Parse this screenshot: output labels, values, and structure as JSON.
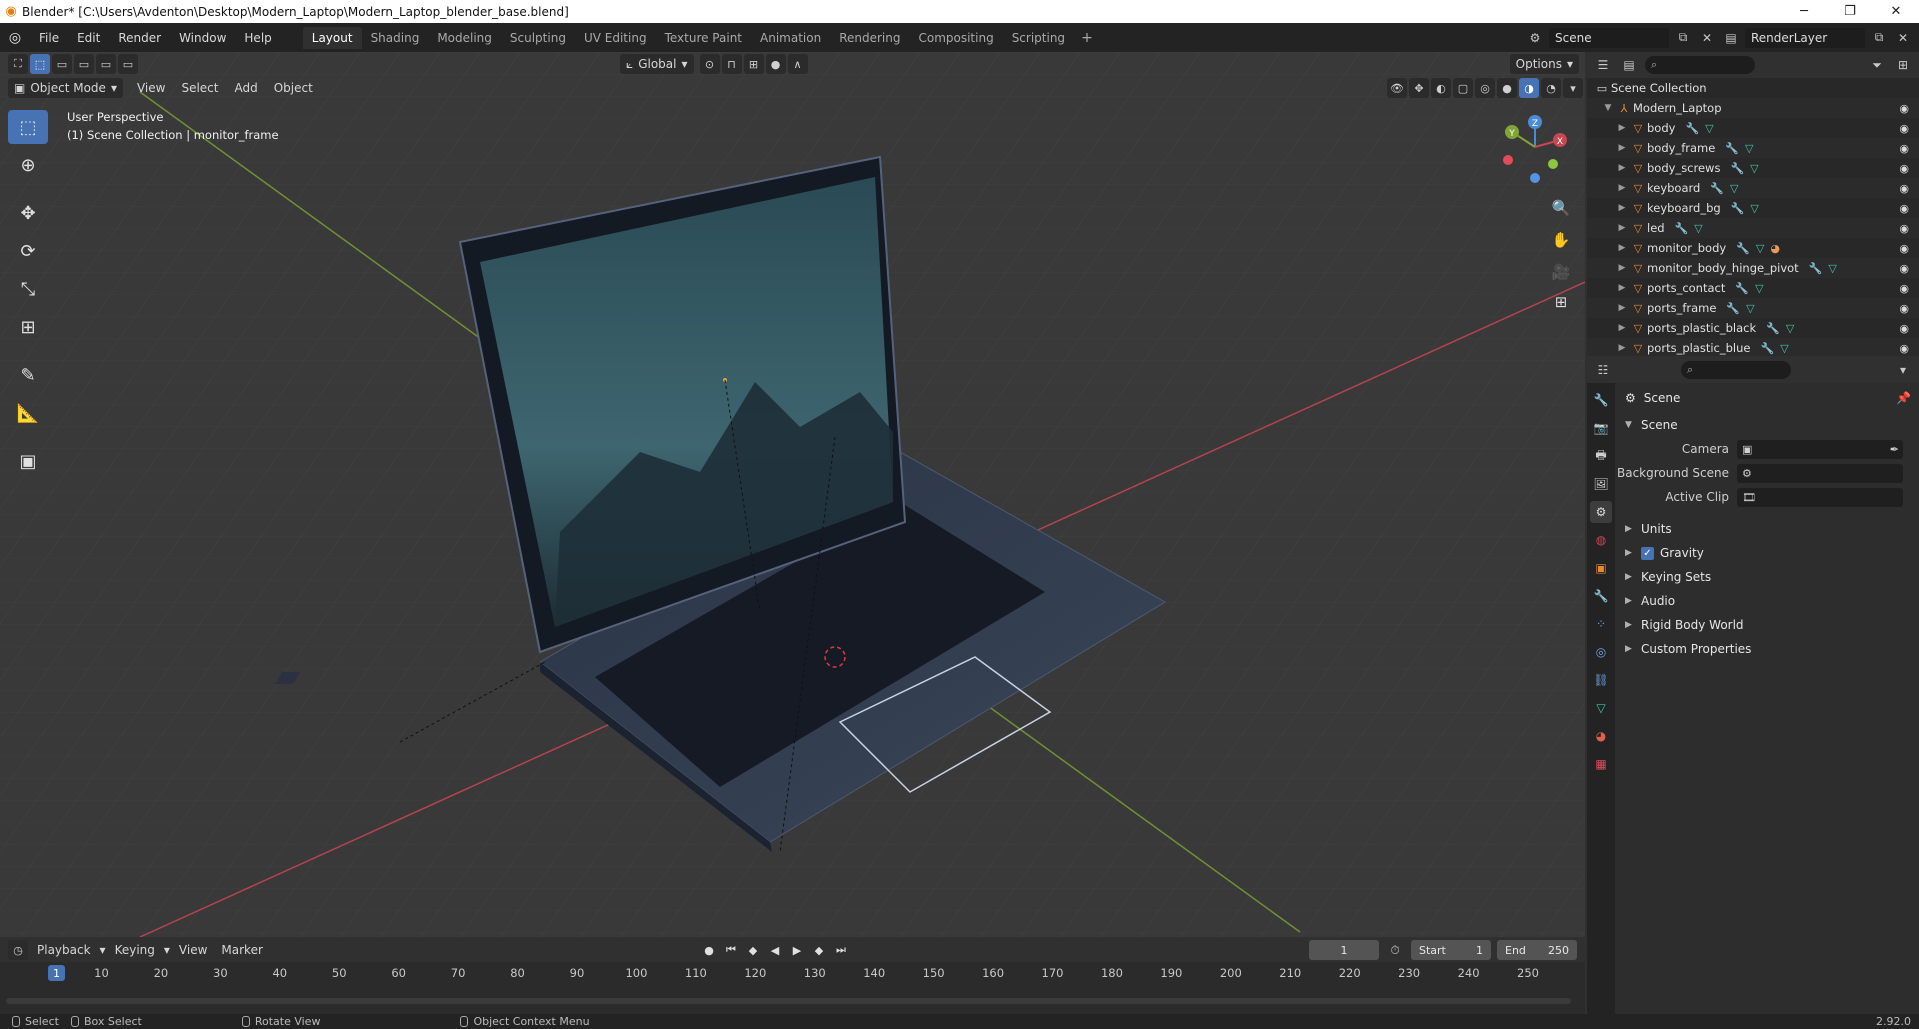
{
  "window": {
    "title": "Blender* [C:\\Users\\Avdenton\\Desktop\\Modern_Laptop\\Modern_Laptop_blender_base.blend]"
  },
  "menu": {
    "items": [
      "File",
      "Edit",
      "Render",
      "Window",
      "Help"
    ]
  },
  "workspaces": {
    "tabs": [
      "Layout",
      "Shading",
      "Modeling",
      "Sculpting",
      "UV Editing",
      "Texture Paint",
      "Animation",
      "Rendering",
      "Compositing",
      "Scripting"
    ],
    "active": "Layout"
  },
  "topright": {
    "scene": "Scene",
    "view_layer": "RenderLayer"
  },
  "viewport": {
    "mode": "Object Mode",
    "menus": [
      "View",
      "Select",
      "Add",
      "Object"
    ],
    "orientation": "Global",
    "options_label": "Options",
    "info_line1": "User Perspective",
    "info_line2": "(1) Scene Collection | monitor_frame",
    "gizmo": {
      "x": "X",
      "y": "Y",
      "z": "Z"
    }
  },
  "outliner": {
    "root": "Scene Collection",
    "collection": "Modern_Laptop",
    "objects": [
      {
        "name": "body",
        "material": false
      },
      {
        "name": "body_frame",
        "material": false
      },
      {
        "name": "body_screws",
        "material": false
      },
      {
        "name": "keyboard",
        "material": false
      },
      {
        "name": "keyboard_bg",
        "material": false
      },
      {
        "name": "led",
        "material": false
      },
      {
        "name": "monitor_body",
        "material": true
      },
      {
        "name": "monitor_body_hinge_pivot",
        "material": false
      },
      {
        "name": "ports_contact",
        "material": false
      },
      {
        "name": "ports_frame",
        "material": false
      },
      {
        "name": "ports_plastic_black",
        "material": false
      },
      {
        "name": "ports_plastic_blue",
        "material": false
      }
    ]
  },
  "properties": {
    "context": "Scene",
    "panel": "Scene",
    "fields": {
      "camera_label": "Camera",
      "background_scene_label": "Background Scene",
      "active_clip_label": "Active Clip"
    },
    "panels": [
      "Units",
      "Gravity",
      "Keying Sets",
      "Audio",
      "Rigid Body World",
      "Custom Properties"
    ],
    "gravity_checked": true
  },
  "timeline": {
    "menus": [
      "Playback",
      "Keying",
      "View",
      "Marker"
    ],
    "current_frame": "1",
    "start_label": "Start",
    "start": "1",
    "end_label": "End",
    "end": "250",
    "ticks": [
      "10",
      "20",
      "30",
      "40",
      "50",
      "60",
      "70",
      "80",
      "90",
      "100",
      "110",
      "120",
      "130",
      "140",
      "150",
      "160",
      "170",
      "180",
      "190",
      "200",
      "210",
      "220",
      "230",
      "240",
      "250"
    ]
  },
  "statusbar": {
    "select": "Select",
    "box_select": "Box Select",
    "rotate_view": "Rotate View",
    "context_menu": "Object Context Menu",
    "version": "2.92.0"
  },
  "colors": {
    "accent": "#4772b3",
    "mesh_icon": "#e6892f",
    "modifier_icon": "#6fa4e0",
    "data_icon": "#41c5a3",
    "x_axis": "#c94750",
    "y_axis": "#7fa535",
    "z_axis": "#4a8bd6"
  }
}
